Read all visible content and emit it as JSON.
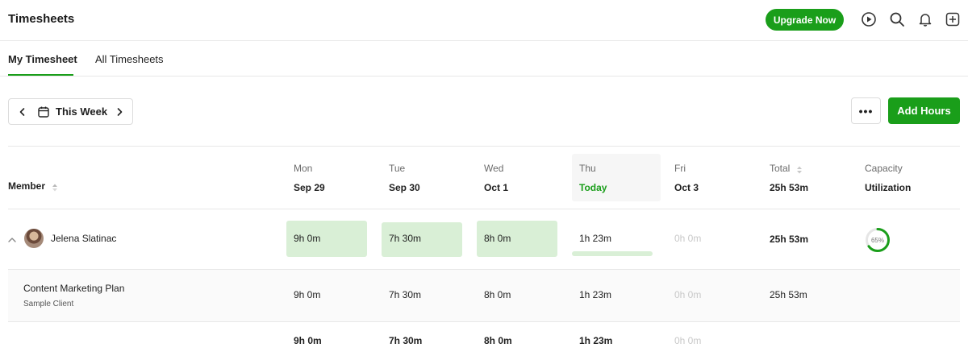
{
  "header": {
    "title": "Timesheets",
    "upgrade_label": "Upgrade Now",
    "icons": [
      "play-circle-icon",
      "search-icon",
      "bell-icon",
      "plus-square-icon"
    ]
  },
  "tabs": [
    {
      "label": "My Timesheet",
      "active": true
    },
    {
      "label": "All Timesheets",
      "active": false
    }
  ],
  "toolbar": {
    "week_label": "This Week",
    "more_label": "•••",
    "add_hours_label": "Add Hours"
  },
  "table": {
    "member_header": "Member",
    "days": [
      {
        "day": "Mon",
        "date": "Sep 29",
        "today": false
      },
      {
        "day": "Tue",
        "date": "Sep 30",
        "today": false
      },
      {
        "day": "Wed",
        "date": "Oct 1",
        "today": false
      },
      {
        "day": "Thu",
        "date": "Today",
        "today": true
      },
      {
        "day": "Fri",
        "date": "Oct 3",
        "today": false
      }
    ],
    "total_header": {
      "top": "Total",
      "bottom": "25h 53m"
    },
    "capacity_header": {
      "top": "Capacity",
      "bottom": "Utilization"
    },
    "member_row": {
      "name": "Jelena Slatinac",
      "hours": [
        "9h 0m",
        "7h 30m",
        "8h 0m",
        "1h 23m",
        "0h 0m"
      ],
      "total": "25h 53m",
      "utilization": "65%",
      "utilization_value": 65
    },
    "project_row": {
      "name": "Content Marketing Plan",
      "client": "Sample Client",
      "hours": [
        "9h 0m",
        "7h 30m",
        "8h 0m",
        "1h 23m",
        "0h 0m"
      ],
      "total": "25h 53m"
    },
    "totals_row": {
      "hours": [
        "9h 0m",
        "7h 30m",
        "8h 0m",
        "1h 23m",
        "0h 0m"
      ]
    }
  },
  "colors": {
    "brand_green": "#1a9e1a",
    "cell_green": "#d9efd6"
  }
}
